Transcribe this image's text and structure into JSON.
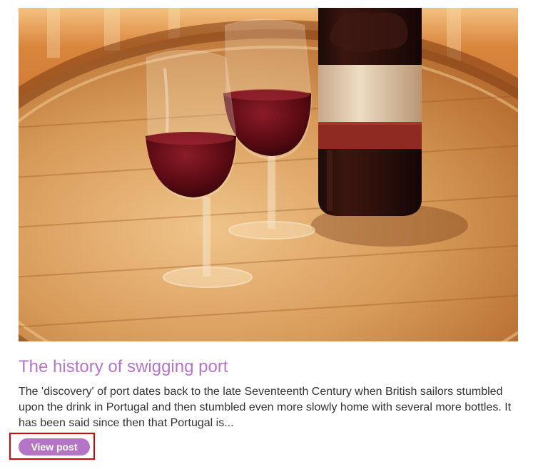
{
  "post": {
    "image_alt": "Two glasses of port wine and a bottle on a wooden barrel",
    "title": "The history of swigging port",
    "excerpt": "The 'discovery' of port dates back to the late Seventeenth Century when British sailors stumbled upon the drink in Portugal and then stumbled even more slowly home with several more bottles. It has been said since then that Portugal is...",
    "view_post_label": "View post"
  },
  "colors": {
    "accent": "#b575c7",
    "highlight": "#e00000",
    "body_text": "#333333"
  }
}
